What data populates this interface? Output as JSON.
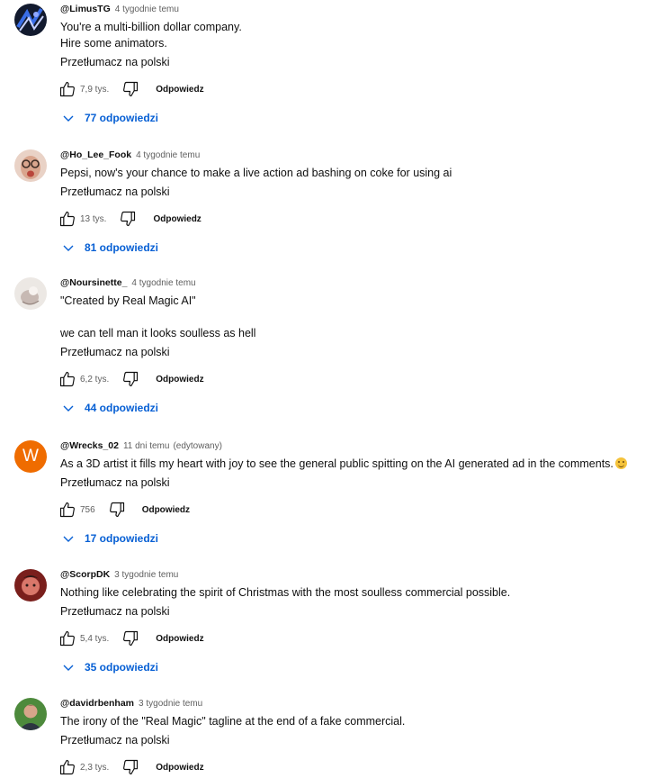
{
  "comments": [
    {
      "author": "@LimusTG",
      "time": "4 tygodnie temu",
      "edited": "",
      "lines": [
        "You're a multi-billion dollar company.",
        "Hire some animators."
      ],
      "translate": "Przetłumacz na polski",
      "likes": "7,9 tys.",
      "reply": "Odpowiedz",
      "replies": "77 odpowiedzi",
      "avatar": {
        "icon": "dark-abstract-avatar-icon",
        "colors": [
          "#121a2e",
          "#3a6ee8",
          "#c8d2ff"
        ]
      }
    },
    {
      "author": "@Ho_Lee_Fook",
      "time": "4 tygodnie temu",
      "edited": "",
      "lines": [
        "Pepsi, now's your chance to make a live action ad bashing on coke for using ai"
      ],
      "translate": "Przetłumacz na polski",
      "likes": "13 tys.",
      "reply": "Odpowiedz",
      "replies": "81 odpowiedzi",
      "avatar": {
        "icon": "face-glasses-avatar-icon",
        "colors": [
          "#e9d2c6",
          "#3b2b24",
          "#b9463b"
        ]
      }
    },
    {
      "author": "@Noursinette_",
      "time": "4 tygodnie temu",
      "edited": "",
      "lines": [
        "\"Created by  Real Magic AI\"",
        "",
        "we can tell man it looks soulless as hell"
      ],
      "translate": "Przetłumacz na polski",
      "likes": "6,2 tys.",
      "reply": "Odpowiedz",
      "replies": "44 odpowiedzi",
      "avatar": {
        "icon": "pale-figure-avatar-icon",
        "colors": [
          "#ece8e4",
          "#c7b9b3",
          "#9a8a84"
        ]
      }
    },
    {
      "author": "@Wrecks_02",
      "time": "11 dni temu",
      "edited": "(edytowany)",
      "lines": [
        "As a 3D artist it fills my heart with joy to see the general public spitting on the AI generated ad in the comments."
      ],
      "emoji": "smile",
      "translate": "Przetłumacz na polski",
      "likes": "756",
      "reply": "Odpowiedz",
      "replies": "17 odpowiedzi",
      "avatar": {
        "icon": "letter-avatar-icon",
        "letter": "W",
        "colors": [
          "#ef6c00"
        ]
      }
    },
    {
      "author": "@ScorpDK",
      "time": "3 tygodnie temu",
      "edited": "",
      "lines": [
        "Nothing like celebrating the spirit of Christmas with the most soulless commercial possible."
      ],
      "translate": "Przetłumacz na polski",
      "likes": "5,4 tys.",
      "reply": "Odpowiedz",
      "replies": "35 odpowiedzi",
      "avatar": {
        "icon": "red-character-avatar-icon",
        "colors": [
          "#7a1f1c",
          "#d9776a",
          "#2b1a17"
        ]
      }
    },
    {
      "author": "@davidrbenham",
      "time": "3 tygodnie temu",
      "edited": "",
      "lines": [
        "The irony of the \"Real Magic\" tagline at the end of a fake commercial."
      ],
      "translate": "Przetłumacz na polski",
      "likes": "2,3 tys.",
      "reply": "Odpowiedz",
      "replies": "",
      "avatar": {
        "icon": "man-photo-avatar-icon",
        "colors": [
          "#4d8a3c",
          "#d7a58a",
          "#2c3540"
        ]
      }
    }
  ],
  "icons": {
    "like": "thumb-up-icon",
    "dislike": "thumb-down-icon",
    "expand": "chevron-down-icon"
  },
  "colors": {
    "link_blue": "#065fd4",
    "meta_gray": "#606060",
    "text": "#0f0f0f"
  }
}
